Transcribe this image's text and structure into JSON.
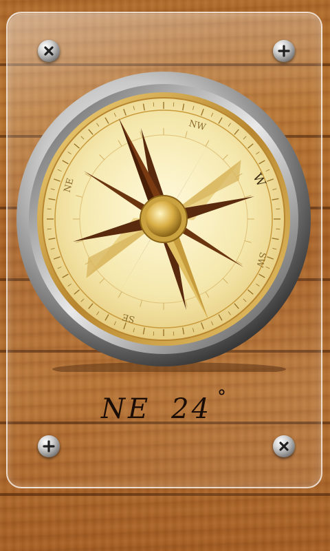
{
  "compass": {
    "direction": "NE",
    "degrees": "24",
    "degree_symbol": "°",
    "heading_value": 24,
    "dial_labels": {
      "north_west": "NW",
      "west": "W",
      "south_west": "SW",
      "south_east": "SE",
      "north_east": "NE"
    }
  },
  "colors": {
    "wood": "#b06a2a",
    "dial_face": "#f7ecb8",
    "gold": "#c79b3a",
    "needle_dark": "#5a2a0e",
    "readout_text": "#1a0d05"
  },
  "icons": {
    "screw_top_left": "screw-x-icon",
    "screw_top_right": "screw-plus-icon",
    "screw_bottom_left": "screw-plus-icon",
    "screw_bottom_right": "screw-x-icon"
  }
}
